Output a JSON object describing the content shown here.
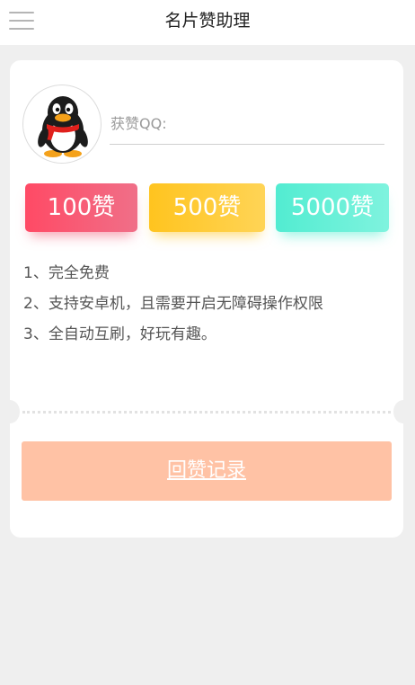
{
  "header": {
    "title": "名片赞助理",
    "menu_icon": "hamburger-menu-icon"
  },
  "form": {
    "qq_label": "获赞QQ:",
    "qq_value": "",
    "avatar_icon": "qq-penguin-logo"
  },
  "like_buttons": [
    {
      "label": "100赞",
      "color": "#ff4a65"
    },
    {
      "label": "500赞",
      "color": "#ffc41f"
    },
    {
      "label": "5000赞",
      "color": "#52ecd1"
    }
  ],
  "rules": [
    "1、完全免费",
    "2、支持安卓机，且需要开启无障碍操作权限",
    "3、全自动互刷，好玩有趣。"
  ],
  "records_button": {
    "label": "回赞记录",
    "color": "#ffc2a5"
  },
  "colors": {
    "background": "#efefef",
    "card": "#ffffff"
  }
}
